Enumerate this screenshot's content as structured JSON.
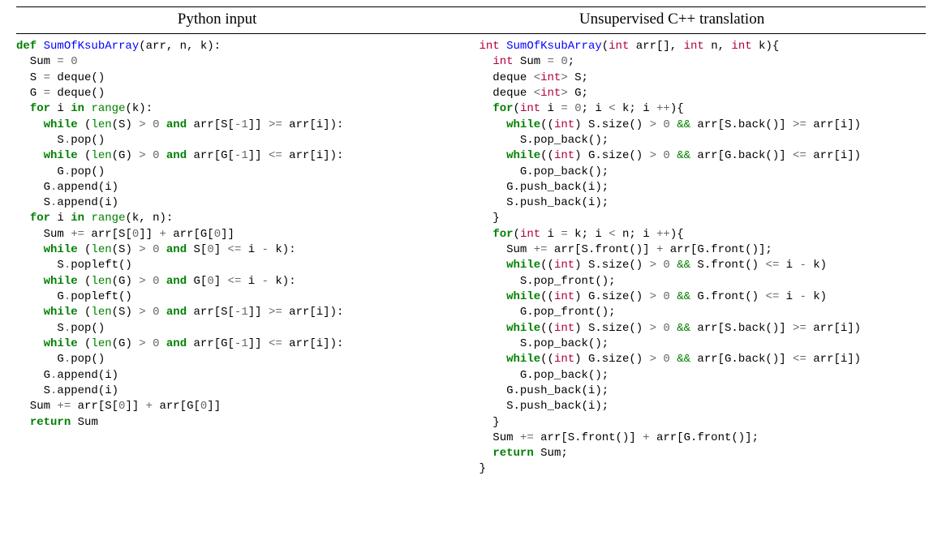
{
  "headers": {
    "left": "Python input",
    "right": "Unsupervised C++ translation"
  },
  "python": {
    "lines": [
      [
        {
          "c": "kw",
          "t": "def "
        },
        {
          "c": "fn",
          "t": "SumOfKsubArray"
        },
        {
          "t": "(arr, n, k):"
        }
      ],
      [
        {
          "t": "  Sum "
        },
        {
          "c": "op",
          "t": "="
        },
        {
          "t": " "
        },
        {
          "c": "num",
          "t": "0"
        }
      ],
      [
        {
          "t": "  S "
        },
        {
          "c": "op",
          "t": "="
        },
        {
          "t": " deque()"
        }
      ],
      [
        {
          "t": "  G "
        },
        {
          "c": "op",
          "t": "="
        },
        {
          "t": " deque()"
        }
      ],
      [
        {
          "t": "  "
        },
        {
          "c": "kw",
          "t": "for"
        },
        {
          "t": " i "
        },
        {
          "c": "kw",
          "t": "in"
        },
        {
          "t": " "
        },
        {
          "c": "builtin",
          "t": "range"
        },
        {
          "t": "(k):"
        }
      ],
      [
        {
          "t": "    "
        },
        {
          "c": "kw",
          "t": "while"
        },
        {
          "t": " ("
        },
        {
          "c": "builtin",
          "t": "len"
        },
        {
          "t": "(S) "
        },
        {
          "c": "op",
          "t": ">"
        },
        {
          "t": " "
        },
        {
          "c": "num",
          "t": "0"
        },
        {
          "t": " "
        },
        {
          "c": "kw",
          "t": "and"
        },
        {
          "t": " arr[S["
        },
        {
          "c": "op",
          "t": "-"
        },
        {
          "c": "num",
          "t": "1"
        },
        {
          "t": "]] "
        },
        {
          "c": "op",
          "t": ">="
        },
        {
          "t": " arr[i]):"
        }
      ],
      [
        {
          "t": "      S"
        },
        {
          "c": "op",
          "t": "."
        },
        {
          "t": "pop()"
        }
      ],
      [
        {
          "t": "    "
        },
        {
          "c": "kw",
          "t": "while"
        },
        {
          "t": " ("
        },
        {
          "c": "builtin",
          "t": "len"
        },
        {
          "t": "(G) "
        },
        {
          "c": "op",
          "t": ">"
        },
        {
          "t": " "
        },
        {
          "c": "num",
          "t": "0"
        },
        {
          "t": " "
        },
        {
          "c": "kw",
          "t": "and"
        },
        {
          "t": " arr[G["
        },
        {
          "c": "op",
          "t": "-"
        },
        {
          "c": "num",
          "t": "1"
        },
        {
          "t": "]] "
        },
        {
          "c": "op",
          "t": "<="
        },
        {
          "t": " arr[i]):"
        }
      ],
      [
        {
          "t": "      G"
        },
        {
          "c": "op",
          "t": "."
        },
        {
          "t": "pop()"
        }
      ],
      [
        {
          "t": "    G"
        },
        {
          "c": "op",
          "t": "."
        },
        {
          "t": "append(i)"
        }
      ],
      [
        {
          "t": "    S"
        },
        {
          "c": "op",
          "t": "."
        },
        {
          "t": "append(i)"
        }
      ],
      [
        {
          "t": "  "
        },
        {
          "c": "kw",
          "t": "for"
        },
        {
          "t": " i "
        },
        {
          "c": "kw",
          "t": "in"
        },
        {
          "t": " "
        },
        {
          "c": "builtin",
          "t": "range"
        },
        {
          "t": "(k, n):"
        }
      ],
      [
        {
          "t": "    Sum "
        },
        {
          "c": "op",
          "t": "+="
        },
        {
          "t": " arr[S["
        },
        {
          "c": "num",
          "t": "0"
        },
        {
          "t": "]] "
        },
        {
          "c": "op",
          "t": "+"
        },
        {
          "t": " arr[G["
        },
        {
          "c": "num",
          "t": "0"
        },
        {
          "t": "]]"
        }
      ],
      [
        {
          "t": "    "
        },
        {
          "c": "kw",
          "t": "while"
        },
        {
          "t": " ("
        },
        {
          "c": "builtin",
          "t": "len"
        },
        {
          "t": "(S) "
        },
        {
          "c": "op",
          "t": ">"
        },
        {
          "t": " "
        },
        {
          "c": "num",
          "t": "0"
        },
        {
          "t": " "
        },
        {
          "c": "kw",
          "t": "and"
        },
        {
          "t": " S["
        },
        {
          "c": "num",
          "t": "0"
        },
        {
          "t": "] "
        },
        {
          "c": "op",
          "t": "<="
        },
        {
          "t": " i "
        },
        {
          "c": "op",
          "t": "-"
        },
        {
          "t": " k):"
        }
      ],
      [
        {
          "t": "      S"
        },
        {
          "c": "op",
          "t": "."
        },
        {
          "t": "popleft()"
        }
      ],
      [
        {
          "t": "    "
        },
        {
          "c": "kw",
          "t": "while"
        },
        {
          "t": " ("
        },
        {
          "c": "builtin",
          "t": "len"
        },
        {
          "t": "(G) "
        },
        {
          "c": "op",
          "t": ">"
        },
        {
          "t": " "
        },
        {
          "c": "num",
          "t": "0"
        },
        {
          "t": " "
        },
        {
          "c": "kw",
          "t": "and"
        },
        {
          "t": " G["
        },
        {
          "c": "num",
          "t": "0"
        },
        {
          "t": "] "
        },
        {
          "c": "op",
          "t": "<="
        },
        {
          "t": " i "
        },
        {
          "c": "op",
          "t": "-"
        },
        {
          "t": " k):"
        }
      ],
      [
        {
          "t": "      G"
        },
        {
          "c": "op",
          "t": "."
        },
        {
          "t": "popleft()"
        }
      ],
      [
        {
          "t": "    "
        },
        {
          "c": "kw",
          "t": "while"
        },
        {
          "t": " ("
        },
        {
          "c": "builtin",
          "t": "len"
        },
        {
          "t": "(S) "
        },
        {
          "c": "op",
          "t": ">"
        },
        {
          "t": " "
        },
        {
          "c": "num",
          "t": "0"
        },
        {
          "t": " "
        },
        {
          "c": "kw",
          "t": "and"
        },
        {
          "t": " arr[S["
        },
        {
          "c": "op",
          "t": "-"
        },
        {
          "c": "num",
          "t": "1"
        },
        {
          "t": "]] "
        },
        {
          "c": "op",
          "t": ">="
        },
        {
          "t": " arr[i]):"
        }
      ],
      [
        {
          "t": "      S"
        },
        {
          "c": "op",
          "t": "."
        },
        {
          "t": "pop()"
        }
      ],
      [
        {
          "t": "    "
        },
        {
          "c": "kw",
          "t": "while"
        },
        {
          "t": " ("
        },
        {
          "c": "builtin",
          "t": "len"
        },
        {
          "t": "(G) "
        },
        {
          "c": "op",
          "t": ">"
        },
        {
          "t": " "
        },
        {
          "c": "num",
          "t": "0"
        },
        {
          "t": " "
        },
        {
          "c": "kw",
          "t": "and"
        },
        {
          "t": " arr[G["
        },
        {
          "c": "op",
          "t": "-"
        },
        {
          "c": "num",
          "t": "1"
        },
        {
          "t": "]] "
        },
        {
          "c": "op",
          "t": "<="
        },
        {
          "t": " arr[i]):"
        }
      ],
      [
        {
          "t": "      G"
        },
        {
          "c": "op",
          "t": "."
        },
        {
          "t": "pop()"
        }
      ],
      [
        {
          "t": "    G"
        },
        {
          "c": "op",
          "t": "."
        },
        {
          "t": "append(i)"
        }
      ],
      [
        {
          "t": "    S"
        },
        {
          "c": "op",
          "t": "."
        },
        {
          "t": "append(i)"
        }
      ],
      [
        {
          "t": "  Sum "
        },
        {
          "c": "op",
          "t": "+="
        },
        {
          "t": " arr[S["
        },
        {
          "c": "num",
          "t": "0"
        },
        {
          "t": "]] "
        },
        {
          "c": "op",
          "t": "+"
        },
        {
          "t": " arr[G["
        },
        {
          "c": "num",
          "t": "0"
        },
        {
          "t": "]]"
        }
      ],
      [
        {
          "t": "  "
        },
        {
          "c": "kw",
          "t": "return"
        },
        {
          "t": " Sum"
        }
      ]
    ]
  },
  "cpp": {
    "lines": [
      [
        {
          "c": "type",
          "t": "int"
        },
        {
          "t": " "
        },
        {
          "c": "fn",
          "t": "SumOfKsubArray"
        },
        {
          "t": "("
        },
        {
          "c": "type",
          "t": "int"
        },
        {
          "t": " arr[], "
        },
        {
          "c": "type",
          "t": "int"
        },
        {
          "t": " n, "
        },
        {
          "c": "type",
          "t": "int"
        },
        {
          "t": " k){"
        }
      ],
      [
        {
          "t": "  "
        },
        {
          "c": "type",
          "t": "int"
        },
        {
          "t": " Sum "
        },
        {
          "c": "op",
          "t": "="
        },
        {
          "t": " "
        },
        {
          "c": "num",
          "t": "0"
        },
        {
          "t": ";"
        }
      ],
      [
        {
          "t": "  deque "
        },
        {
          "c": "br",
          "t": "<"
        },
        {
          "c": "type",
          "t": "int"
        },
        {
          "c": "br",
          "t": ">"
        },
        {
          "t": " S;"
        }
      ],
      [
        {
          "t": "  deque "
        },
        {
          "c": "br",
          "t": "<"
        },
        {
          "c": "type",
          "t": "int"
        },
        {
          "c": "br",
          "t": ">"
        },
        {
          "t": " G;"
        }
      ],
      [
        {
          "t": "  "
        },
        {
          "c": "kw-c",
          "t": "for"
        },
        {
          "t": "("
        },
        {
          "c": "type",
          "t": "int"
        },
        {
          "t": " i "
        },
        {
          "c": "op",
          "t": "="
        },
        {
          "t": " "
        },
        {
          "c": "num",
          "t": "0"
        },
        {
          "t": "; i "
        },
        {
          "c": "op",
          "t": "<"
        },
        {
          "t": " k; i "
        },
        {
          "c": "op",
          "t": "++"
        },
        {
          "t": "){"
        }
      ],
      [
        {
          "t": "    "
        },
        {
          "c": "kw-c",
          "t": "while"
        },
        {
          "t": "(("
        },
        {
          "c": "type",
          "t": "int"
        },
        {
          "t": ") S.size() "
        },
        {
          "c": "op",
          "t": ">"
        },
        {
          "t": " "
        },
        {
          "c": "num",
          "t": "0"
        },
        {
          "t": " "
        },
        {
          "c": "amp",
          "t": "&&"
        },
        {
          "t": " arr[S.back()] "
        },
        {
          "c": "op",
          "t": ">="
        },
        {
          "t": " arr[i])"
        }
      ],
      [
        {
          "t": "      S.pop_back();"
        }
      ],
      [
        {
          "t": "    "
        },
        {
          "c": "kw-c",
          "t": "while"
        },
        {
          "t": "(("
        },
        {
          "c": "type",
          "t": "int"
        },
        {
          "t": ") G.size() "
        },
        {
          "c": "op",
          "t": ">"
        },
        {
          "t": " "
        },
        {
          "c": "num",
          "t": "0"
        },
        {
          "t": " "
        },
        {
          "c": "amp",
          "t": "&&"
        },
        {
          "t": " arr[G.back()] "
        },
        {
          "c": "op",
          "t": "<="
        },
        {
          "t": " arr[i])"
        }
      ],
      [
        {
          "t": "      G.pop_back();"
        }
      ],
      [
        {
          "t": "    G.push_back(i);"
        }
      ],
      [
        {
          "t": "    S.push_back(i);"
        }
      ],
      [
        {
          "t": "  }"
        }
      ],
      [
        {
          "t": "  "
        },
        {
          "c": "kw-c",
          "t": "for"
        },
        {
          "t": "("
        },
        {
          "c": "type",
          "t": "int"
        },
        {
          "t": " i "
        },
        {
          "c": "op",
          "t": "="
        },
        {
          "t": " k; i "
        },
        {
          "c": "op",
          "t": "<"
        },
        {
          "t": " n; i "
        },
        {
          "c": "op",
          "t": "++"
        },
        {
          "t": "){"
        }
      ],
      [
        {
          "t": "    Sum "
        },
        {
          "c": "op",
          "t": "+="
        },
        {
          "t": " arr[S.front()] "
        },
        {
          "c": "op",
          "t": "+"
        },
        {
          "t": " arr[G.front()];"
        }
      ],
      [
        {
          "t": "    "
        },
        {
          "c": "kw-c",
          "t": "while"
        },
        {
          "t": "(("
        },
        {
          "c": "type",
          "t": "int"
        },
        {
          "t": ") S.size() "
        },
        {
          "c": "op",
          "t": ">"
        },
        {
          "t": " "
        },
        {
          "c": "num",
          "t": "0"
        },
        {
          "t": " "
        },
        {
          "c": "amp",
          "t": "&&"
        },
        {
          "t": " S.front() "
        },
        {
          "c": "op",
          "t": "<="
        },
        {
          "t": " i "
        },
        {
          "c": "op",
          "t": "-"
        },
        {
          "t": " k)"
        }
      ],
      [
        {
          "t": "      S.pop_front();"
        }
      ],
      [
        {
          "t": "    "
        },
        {
          "c": "kw-c",
          "t": "while"
        },
        {
          "t": "(("
        },
        {
          "c": "type",
          "t": "int"
        },
        {
          "t": ") G.size() "
        },
        {
          "c": "op",
          "t": ">"
        },
        {
          "t": " "
        },
        {
          "c": "num",
          "t": "0"
        },
        {
          "t": " "
        },
        {
          "c": "amp",
          "t": "&&"
        },
        {
          "t": " G.front() "
        },
        {
          "c": "op",
          "t": "<="
        },
        {
          "t": " i "
        },
        {
          "c": "op",
          "t": "-"
        },
        {
          "t": " k)"
        }
      ],
      [
        {
          "t": "      G.pop_front();"
        }
      ],
      [
        {
          "t": "    "
        },
        {
          "c": "kw-c",
          "t": "while"
        },
        {
          "t": "(("
        },
        {
          "c": "type",
          "t": "int"
        },
        {
          "t": ") S.size() "
        },
        {
          "c": "op",
          "t": ">"
        },
        {
          "t": " "
        },
        {
          "c": "num",
          "t": "0"
        },
        {
          "t": " "
        },
        {
          "c": "amp",
          "t": "&&"
        },
        {
          "t": " arr[S.back()] "
        },
        {
          "c": "op",
          "t": ">="
        },
        {
          "t": " arr[i])"
        }
      ],
      [
        {
          "t": "      S.pop_back();"
        }
      ],
      [
        {
          "t": "    "
        },
        {
          "c": "kw-c",
          "t": "while"
        },
        {
          "t": "(("
        },
        {
          "c": "type",
          "t": "int"
        },
        {
          "t": ") G.size() "
        },
        {
          "c": "op",
          "t": ">"
        },
        {
          "t": " "
        },
        {
          "c": "num",
          "t": "0"
        },
        {
          "t": " "
        },
        {
          "c": "amp",
          "t": "&&"
        },
        {
          "t": " arr[G.back()] "
        },
        {
          "c": "op",
          "t": "<="
        },
        {
          "t": " arr[i])"
        }
      ],
      [
        {
          "t": "      G.pop_back();"
        }
      ],
      [
        {
          "t": "    G.push_back(i);"
        }
      ],
      [
        {
          "t": "    S.push_back(i);"
        }
      ],
      [
        {
          "t": "  }"
        }
      ],
      [
        {
          "t": "  Sum "
        },
        {
          "c": "op",
          "t": "+="
        },
        {
          "t": " arr[S.front()] "
        },
        {
          "c": "op",
          "t": "+"
        },
        {
          "t": " arr[G.front()];"
        }
      ],
      [
        {
          "t": "  "
        },
        {
          "c": "kw-c",
          "t": "return"
        },
        {
          "t": " Sum;"
        }
      ],
      [
        {
          "t": "}"
        }
      ]
    ]
  }
}
